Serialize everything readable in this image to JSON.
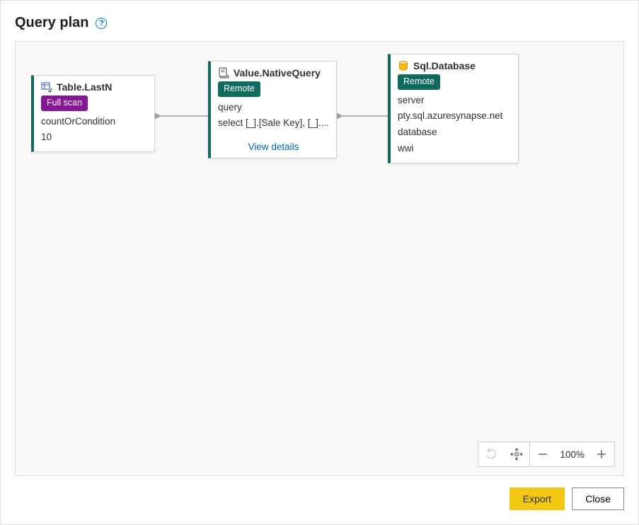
{
  "dialog": {
    "title": "Query plan"
  },
  "nodes": {
    "tableLastN": {
      "title": "Table.LastN",
      "badge": "Full scan",
      "prop_label": "countOrCondition",
      "prop_value": "10"
    },
    "nativeQuery": {
      "title": "Value.NativeQuery",
      "badge": "Remote",
      "prop_label": "query",
      "prop_value": "select [_].[Sale Key], [_]....",
      "view_details": "View details"
    },
    "sqlDatabase": {
      "title": "Sql.Database",
      "badge": "Remote",
      "server_label": "server",
      "server_value": "pty.sql.azuresynapse.net",
      "db_label": "database",
      "db_value": "wwi"
    }
  },
  "toolbar": {
    "zoom": "100%"
  },
  "footer": {
    "export": "Export",
    "close": "Close"
  },
  "colors": {
    "accent_teal": "#0f6b5d",
    "accent_purple": "#881798",
    "accent_yellow": "#f2c811",
    "link_blue": "#0067b8"
  }
}
